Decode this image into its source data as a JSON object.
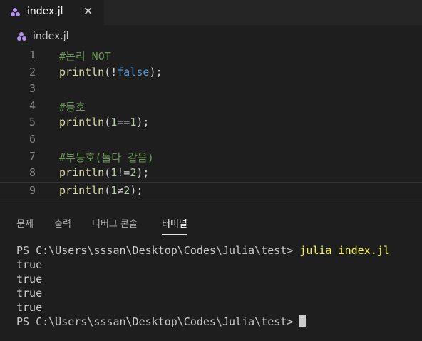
{
  "tab": {
    "label": "index.jl",
    "close": "✕"
  },
  "breadcrumb": {
    "label": "index.jl"
  },
  "editor": {
    "lines": [
      {
        "n": "1",
        "tokens": [
          {
            "t": "#논리 NOT",
            "k": "comment"
          }
        ]
      },
      {
        "n": "2",
        "tokens": [
          {
            "t": "println",
            "k": "fn"
          },
          {
            "t": "(!",
            "k": "punc"
          },
          {
            "t": "false",
            "k": "kw"
          },
          {
            "t": ");",
            "k": "punc"
          }
        ]
      },
      {
        "n": "3",
        "tokens": []
      },
      {
        "n": "4",
        "tokens": [
          {
            "t": "#등호",
            "k": "comment"
          }
        ]
      },
      {
        "n": "5",
        "tokens": [
          {
            "t": "println",
            "k": "fn"
          },
          {
            "t": "(",
            "k": "punc"
          },
          {
            "t": "1",
            "k": "num"
          },
          {
            "t": "==",
            "k": "op"
          },
          {
            "t": "1",
            "k": "num"
          },
          {
            "t": ");",
            "k": "punc"
          }
        ]
      },
      {
        "n": "6",
        "tokens": []
      },
      {
        "n": "7",
        "tokens": [
          {
            "t": "#부등호(둘다 같음)",
            "k": "comment"
          }
        ]
      },
      {
        "n": "8",
        "tokens": [
          {
            "t": "println",
            "k": "fn"
          },
          {
            "t": "(",
            "k": "punc"
          },
          {
            "t": "1",
            "k": "num"
          },
          {
            "t": "!=",
            "k": "op"
          },
          {
            "t": "2",
            "k": "num"
          },
          {
            "t": ");",
            "k": "punc"
          }
        ]
      },
      {
        "n": "9",
        "tokens": [
          {
            "t": "println",
            "k": "fn"
          },
          {
            "t": "(",
            "k": "punc"
          },
          {
            "t": "1",
            "k": "num"
          },
          {
            "t": "≠",
            "k": "op"
          },
          {
            "t": "2",
            "k": "num"
          },
          {
            "t": ");",
            "k": "punc"
          }
        ],
        "current": true
      }
    ]
  },
  "panel": {
    "tabs": [
      {
        "label": "문제",
        "active": false
      },
      {
        "label": "출력",
        "active": false
      },
      {
        "label": "디버그 콘솔",
        "active": false
      },
      {
        "label": "터미널",
        "active": true
      }
    ]
  },
  "terminal": {
    "prompt": "PS C:\\Users\\sssan\\Desktop\\Codes\\Julia\\test> ",
    "command": "julia index.jl",
    "outputs": [
      "true",
      "true",
      "true",
      "true"
    ]
  },
  "colors": {
    "background": "#1e1e1e",
    "comment": "#6a9955",
    "function": "#dcdcaa",
    "keyword": "#569cd6",
    "number": "#b5cea8",
    "terminal_command": "#f5f543",
    "julia_icon": "#b392f0"
  },
  "icons": {
    "file": "julia-file-icon",
    "close": "close-icon"
  }
}
